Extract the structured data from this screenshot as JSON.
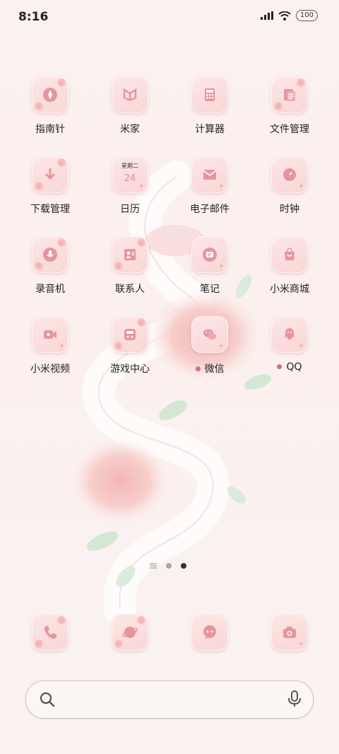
{
  "status": {
    "time": "8:16",
    "battery": "100"
  },
  "apps": [
    {
      "label": "指南针",
      "icon": "compass-icon"
    },
    {
      "label": "米家",
      "icon": "mi-home-icon"
    },
    {
      "label": "计算器",
      "icon": "calculator-icon"
    },
    {
      "label": "文件管理",
      "icon": "file-manager-icon"
    },
    {
      "label": "下载管理",
      "icon": "download-icon"
    },
    {
      "label": "日历",
      "icon": "calendar-icon",
      "cal_weekday": "星期二",
      "cal_day": "24"
    },
    {
      "label": "电子邮件",
      "icon": "mail-icon"
    },
    {
      "label": "时钟",
      "icon": "clock-icon"
    },
    {
      "label": "录音机",
      "icon": "recorder-icon"
    },
    {
      "label": "联系人",
      "icon": "contacts-icon"
    },
    {
      "label": "笔记",
      "icon": "notes-icon"
    },
    {
      "label": "小米商城",
      "icon": "shop-icon"
    },
    {
      "label": "小米视频",
      "icon": "video-icon"
    },
    {
      "label": "游戏中心",
      "icon": "game-center-icon"
    },
    {
      "label": "微信",
      "icon": "wechat-icon",
      "new": true
    },
    {
      "label": "QQ",
      "icon": "qq-icon",
      "new": true
    }
  ],
  "dock": [
    {
      "icon": "phone-icon"
    },
    {
      "icon": "browser-icon"
    },
    {
      "icon": "messages-icon"
    },
    {
      "icon": "camera-icon"
    }
  ],
  "page_indicator": {
    "pages": 2,
    "current": 2
  },
  "colors": {
    "accent": "#e58d95",
    "tile": "#f8d6d6",
    "badge_dot": "#d86b7a"
  }
}
